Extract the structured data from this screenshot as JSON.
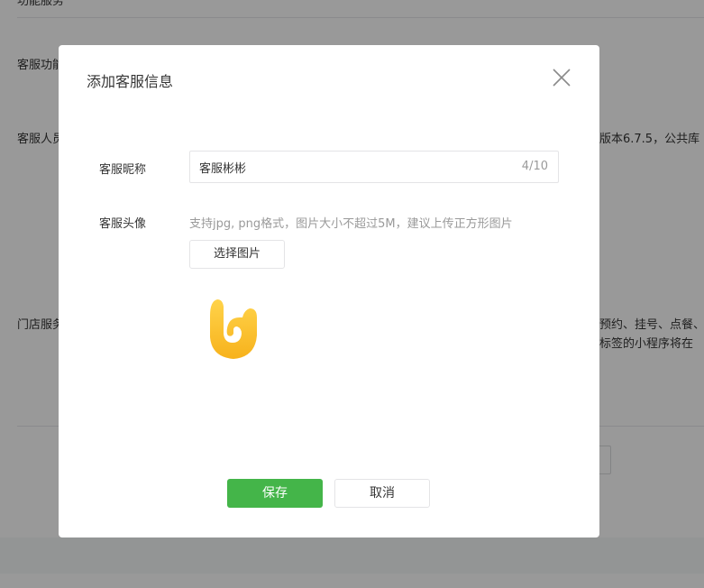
{
  "background": {
    "section_top": "功能服务",
    "label_features": "客服功能",
    "label_staff": "客服人员",
    "right_text_1": "版本6.7.5，公共库",
    "label_store": "门店服务",
    "right_text_2": "预约、挂号、点餐、",
    "right_text_3": "标签的小程序将在"
  },
  "dialog": {
    "title": "添加客服信息",
    "close_icon": "close-icon",
    "nickname_label": "客服昵称",
    "nickname_value": "客服彬彬",
    "nickname_counter": "4/10",
    "avatar_label": "客服头像",
    "avatar_hint": "支持jpg, png格式，图片大小不超过5M，建议上传正方形图片",
    "choose_image_label": "选择图片",
    "avatar_icon": "avatar-image",
    "save_label": "保存",
    "cancel_label": "取消"
  },
  "colors": {
    "primary": "#44b549",
    "overlay": "rgba(0,0,0,0.40)",
    "avatar_yellow": "#fbbf2e"
  }
}
